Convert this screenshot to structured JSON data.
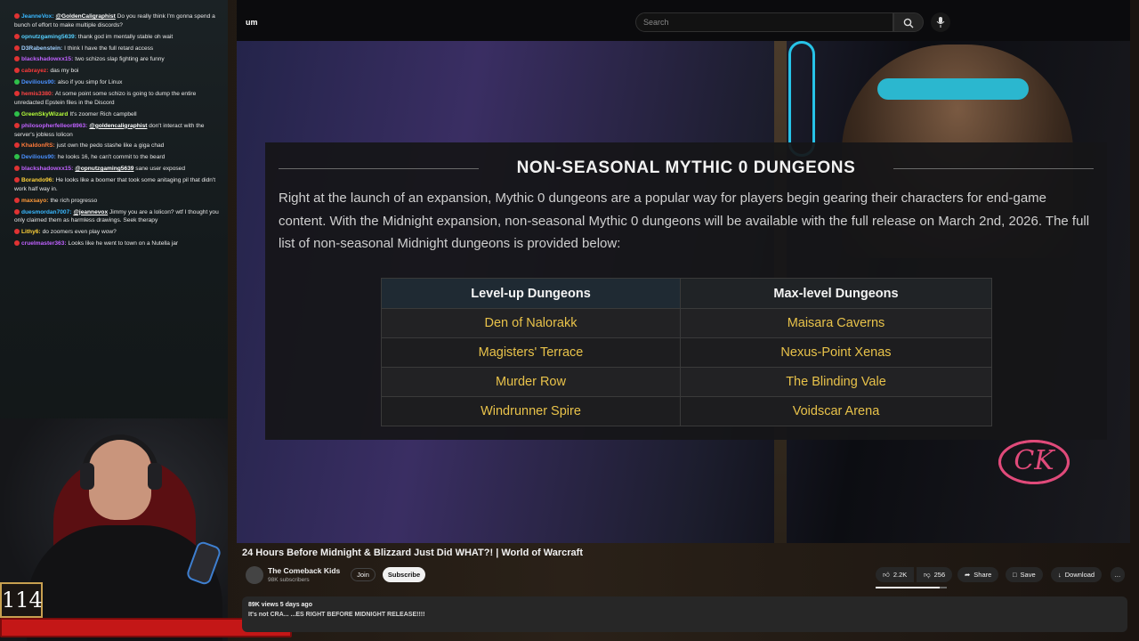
{
  "chat": {
    "messages": [
      {
        "user": "JeanneVox:",
        "user_color": "#39b8ff",
        "mention": "@GoldenCaligraphist",
        "text": "Do you really think I'm gonna spend a bunch of effort to make multiple discords?",
        "badge_color": "#e03333"
      },
      {
        "user": "opnutzgaming5639:",
        "user_color": "#55d0ff",
        "mention": "",
        "text": "thank god im mentally stable oh wait",
        "badge_color": "#e03333"
      },
      {
        "user": "D3Rabenstein:",
        "user_color": "#a0d0ff",
        "mention": "",
        "text": "I think I have the full retard access",
        "badge_color": "#e03333"
      },
      {
        "user": "blackshadowxx15:",
        "user_color": "#c061ff",
        "mention": "",
        "text": "two schizos slap fighting are funny",
        "badge_color": "#e03333"
      },
      {
        "user": "cabrayez:",
        "user_color": "#ff3a3a",
        "mention": "",
        "text": "das my boi",
        "badge_color": "#e03333"
      },
      {
        "user": "Devilious90:",
        "user_color": "#4a90ff",
        "mention": "",
        "text": "also if you simp for Linux",
        "badge_color": "#2fbf4a"
      },
      {
        "user": "hemis3380:",
        "user_color": "#ff4444",
        "mention": "",
        "text": "At some point some schizo is going to dump the entire unredacted Epstein files in the Discord",
        "badge_color": "#e03333"
      },
      {
        "user": "GreenSkyWizard",
        "user_color": "#b6ff3a",
        "mention": "",
        "text": "It's zoomer Rich campbell",
        "badge_color": "#2fbf4a"
      },
      {
        "user": "philosopherfelleor8963:",
        "user_color": "#c061ff",
        "mention": "@goldencaligraphist",
        "text": "don't interact with the server's jobless lolicon",
        "badge_color": "#e03333"
      },
      {
        "user": "KhaldonRS:",
        "user_color": "#ff7a3a",
        "mention": "",
        "text": "just own the pedo stashe like a giga chad",
        "badge_color": "#e03333"
      },
      {
        "user": "Devilious90:",
        "user_color": "#4a90ff",
        "mention": "",
        "text": "he looks 16, he can't commit to the beard",
        "badge_color": "#2fbf4a"
      },
      {
        "user": "blackshadowxx15:",
        "user_color": "#c061ff",
        "mention": "@opnutzgaming5639",
        "text": "sane user exposed",
        "badge_color": "#e03333"
      },
      {
        "user": "Borando96:",
        "user_color": "#ffd23a",
        "mention": "",
        "text": "He looks like a boomer that took some anitaging pil that didn't work half way in.",
        "badge_color": "#e03333"
      },
      {
        "user": "maxsayo:",
        "user_color": "#ff9a3a",
        "mention": "",
        "text": "the rich progresso",
        "badge_color": "#e03333"
      },
      {
        "user": "duesmordan7007:",
        "user_color": "#39b8ff",
        "mention": "@jeannevox",
        "text": "Jimmy you are a lolicon? wtf I thought you only claimed them as harmless drawings. Seek therapy",
        "badge_color": "#e03333"
      },
      {
        "user": "Lithy6:",
        "user_color": "#ffd23a",
        "mention": "",
        "text": "do zoomers even play wow?",
        "badge_color": "#e03333"
      },
      {
        "user": "cruelmaster363:",
        "user_color": "#c061ff",
        "mention": "",
        "text": "Looks like he went to town on a Nutella jar",
        "badge_color": "#e03333"
      }
    ]
  },
  "stream": {
    "counter": "114"
  },
  "youtube": {
    "logo_fragment": "um",
    "search_placeholder": "Search",
    "search_icon": "search-icon",
    "mic_icon": "microphone-icon"
  },
  "overlay": {
    "title": "NON-SEASONAL MYTHIC 0 DUNGEONS",
    "paragraph": "Right at the launch of an expansion, Mythic 0 dungeons are a popular way for players begin gearing their characters for end-game content. With the Midnight expansion, non-seasonal Mythic 0 dungeons will be available with the full release on March 2nd, 2026. The full list of non-seasonal Midnight dungeons is provided below:",
    "table": {
      "headers": [
        "Level-up Dungeons",
        "Max-level Dungeons"
      ],
      "rows": [
        [
          "Den of Nalorakk",
          "Maisara Caverns"
        ],
        [
          "Magisters' Terrace",
          "Nexus-Point Xenas"
        ],
        [
          "Murder Row",
          "The Blinding Vale"
        ],
        [
          "Windrunner Spire",
          "Voidscar Arena"
        ]
      ]
    },
    "logo_text": "CK"
  },
  "video": {
    "title": "24 Hours Before Midnight & Blizzard Just Did WHAT?! | World of Warcraft",
    "channel": "The Comeback Kids",
    "subscribers": "98K subscribers",
    "join_label": "Join",
    "subscribe_label": "Subscribe",
    "likes": "2.2K",
    "dislikes": "256",
    "share_label": "Share",
    "save_label": "Save",
    "download_label": "Download",
    "more_label": "…",
    "like_ratio": 0.9,
    "meta": "89K views  5 days ago",
    "desc_line": "It's not CRA...  ...ES RIGHT BEFORE MIDNIGHT RELEASE!!!!"
  }
}
